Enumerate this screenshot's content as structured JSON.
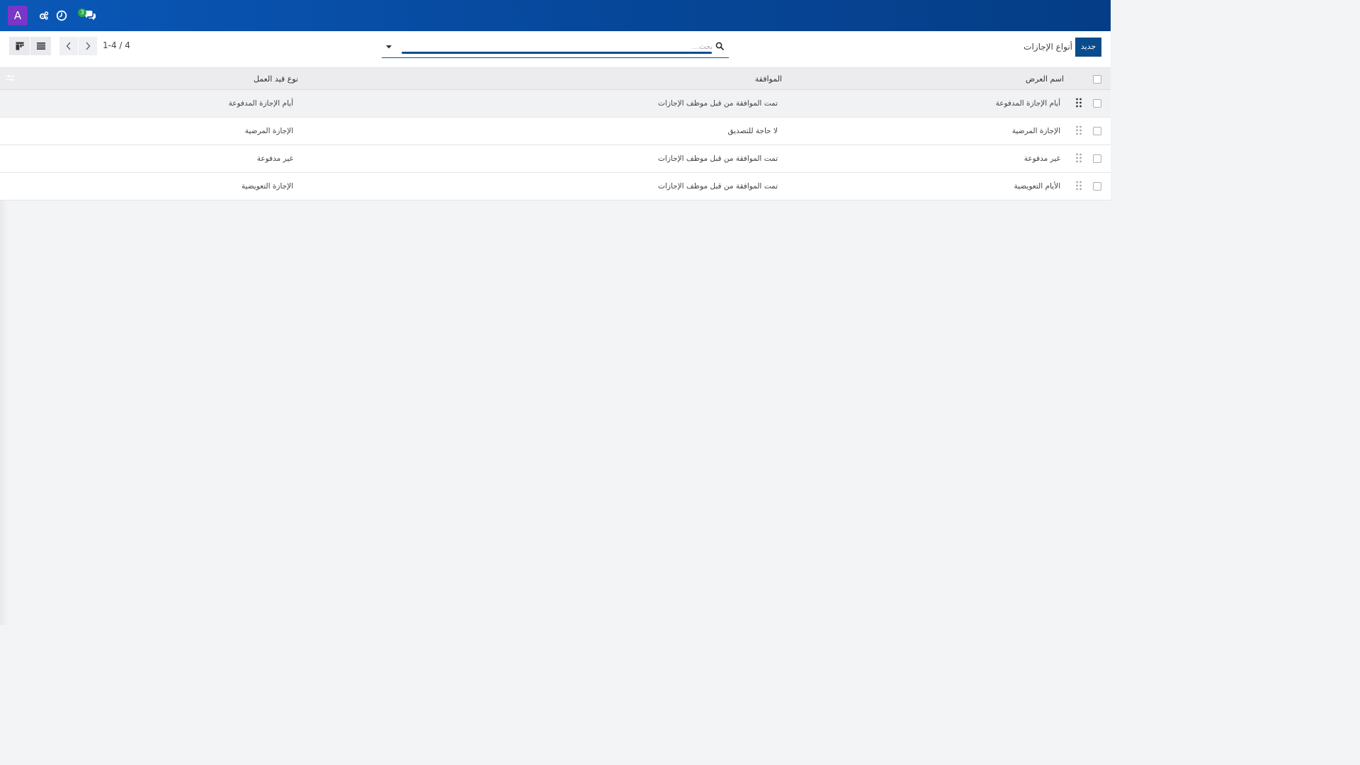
{
  "navbar": {
    "avatar_letter": "A",
    "icons": [
      "settings-cogs-icon",
      "clock-icon",
      "chat-icon"
    ],
    "chat_badge": "3",
    "colors": {
      "bar": "#0a58b8",
      "avatar": "#7a35c9",
      "badge": "#2aa84a"
    }
  },
  "control_panel": {
    "new_button": "جديد",
    "breadcrumb": "أنواع الإجازات",
    "search": {
      "placeholder": "بحث...",
      "value": ""
    },
    "pager": {
      "value": "1-4 / 4"
    },
    "views": [
      "kanban-view-icon",
      "list-view-icon"
    ]
  },
  "table": {
    "headers": {
      "name": "اسم العرض",
      "approval": "الموافقة",
      "work_entry_type": "نوع قيد العمل"
    },
    "rows": [
      {
        "name": "أيام الإجازة المدفوعة",
        "approval": "تمت الموافقة من قبل موظف الإجازات",
        "work_entry_type": "أيام الإجازة المدفوعة"
      },
      {
        "name": "الإجازة المرضية",
        "approval": "لا حاجة للتصديق",
        "work_entry_type": "الإجازة المرضية"
      },
      {
        "name": "غير مدفوعة",
        "approval": "تمت الموافقة من قبل موظف الإجازات",
        "work_entry_type": "غير مدفوعة"
      },
      {
        "name": "الأيام التعويضية",
        "approval": "تمت الموافقة من قبل موظف الإجازات",
        "work_entry_type": "الإجازة التعويضية"
      }
    ]
  }
}
